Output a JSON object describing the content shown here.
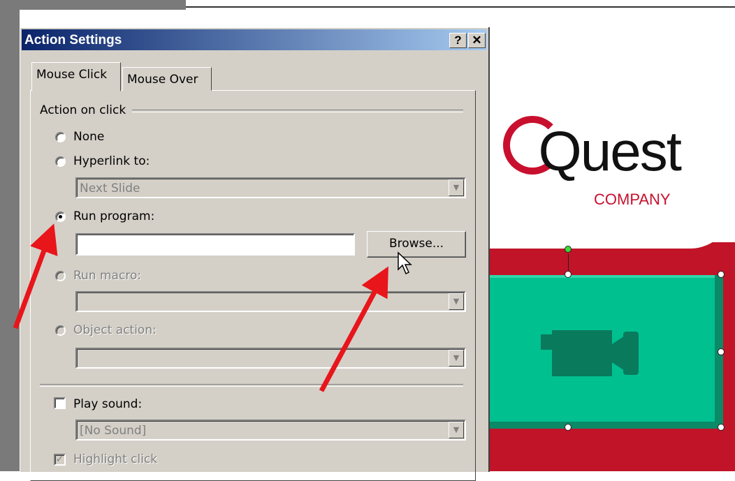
{
  "dialog": {
    "title": "Action Settings",
    "help_label": "?",
    "close_label": "✕",
    "tabs": [
      {
        "label": "Mouse Click",
        "active": true
      },
      {
        "label": "Mouse Over",
        "active": false
      }
    ],
    "group_label": "Action on click",
    "options": {
      "none": "None",
      "hyperlink": "Hyperlink to:",
      "hyperlink_value": "Next Slide",
      "run_program": "Run program:",
      "run_program_value": "",
      "browse": "Browse...",
      "run_macro": "Run macro:",
      "run_macro_value": "",
      "object_action": "Object action:",
      "object_action_value": ""
    },
    "selected_option": "run_program",
    "play_sound": {
      "label": "Play sound:",
      "checked": false,
      "value": "[No Sound]"
    },
    "highlight_click": {
      "label": "Highlight click",
      "checked": true,
      "disabled": true
    },
    "combo_arrow": "▼"
  },
  "slide": {
    "logo_text": "Quest",
    "logo_prefix": "o",
    "logo_subtitle": "COMPANY",
    "colors": {
      "red": "#c11428",
      "green": "#00c090",
      "green_dark": "#0a8a66"
    },
    "button_icon": "video-camera-icon"
  },
  "annotations": {
    "arrow_color": "#e8151b"
  }
}
